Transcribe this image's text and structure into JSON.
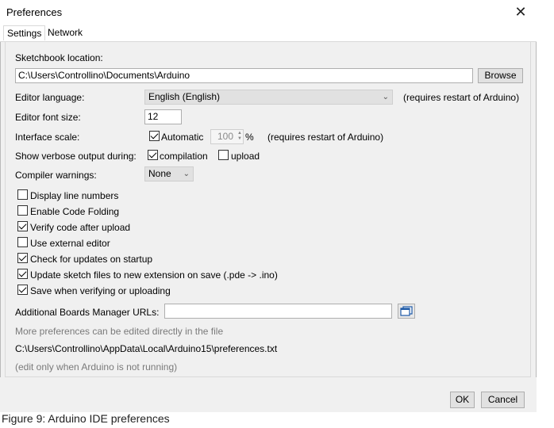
{
  "window": {
    "title": "Preferences"
  },
  "tabs": [
    {
      "label": "Settings"
    },
    {
      "label": "Network"
    }
  ],
  "sketchbook": {
    "label": "Sketchbook location:",
    "value": "C:\\Users\\Controllino\\Documents\\Arduino",
    "browse_label": "Browse"
  },
  "editor_language": {
    "label": "Editor language:",
    "value": "English (English)",
    "note": "(requires restart of Arduino)"
  },
  "editor_font_size": {
    "label": "Editor font size:",
    "value": "12"
  },
  "interface_scale": {
    "label": "Interface scale:",
    "automatic_label": "Automatic",
    "automatic_checked": true,
    "value": "100",
    "unit": "%",
    "note": "(requires restart of Arduino)"
  },
  "verbose": {
    "label": "Show verbose output during:",
    "compilation_label": "compilation",
    "compilation_checked": true,
    "upload_label": "upload",
    "upload_checked": false
  },
  "compiler_warnings": {
    "label": "Compiler warnings:",
    "value": "None"
  },
  "options": [
    {
      "label": "Display line numbers",
      "checked": false
    },
    {
      "label": "Enable Code Folding",
      "checked": false
    },
    {
      "label": "Verify code after upload",
      "checked": true
    },
    {
      "label": "Use external editor",
      "checked": false
    },
    {
      "label": "Check for updates on startup",
      "checked": true
    },
    {
      "label": "Update sketch files to new extension on save (.pde -> .ino)",
      "checked": true
    },
    {
      "label": "Save when verifying or uploading",
      "checked": true
    }
  ],
  "boards_manager": {
    "label": "Additional Boards Manager URLs:",
    "value": ""
  },
  "more_prefs_text": "More preferences can be edited directly in the file",
  "prefs_path": "C:\\Users\\Controllino\\AppData\\Local\\Arduino15\\preferences.txt",
  "edit_note": "(edit only when Arduino is not running)",
  "buttons": {
    "ok": "OK",
    "cancel": "Cancel"
  },
  "caption": "Figure 9: Arduino IDE preferences"
}
